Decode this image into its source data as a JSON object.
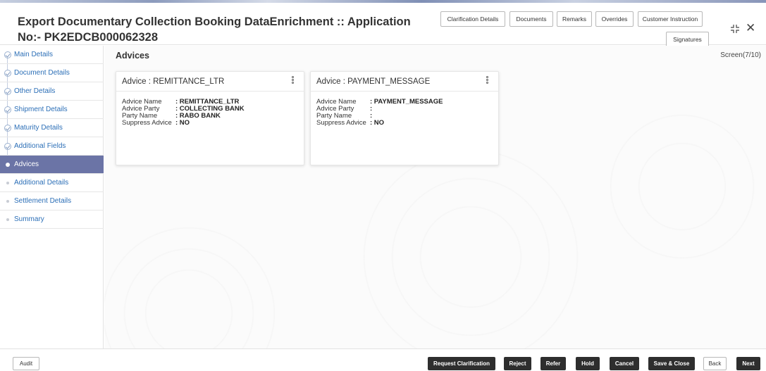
{
  "header": {
    "title": "Export Documentary Collection Booking DataEnrichment :: Application No:- PK2EDCB000062328",
    "buttons": [
      "Clarification Details",
      "Documents",
      "Remarks",
      "Overrides",
      "Customer Instruction",
      "Signatures"
    ],
    "close_glyph": "✕"
  },
  "sidebar": {
    "items": [
      {
        "label": "Main Details",
        "state": "done"
      },
      {
        "label": "Document Details",
        "state": "done"
      },
      {
        "label": "Other Details",
        "state": "done"
      },
      {
        "label": "Shipment Details",
        "state": "done"
      },
      {
        "label": "Maturity Details",
        "state": "done"
      },
      {
        "label": "Additional Fields",
        "state": "done"
      },
      {
        "label": "Advices",
        "state": "active"
      },
      {
        "label": "Additional Details",
        "state": "pending"
      },
      {
        "label": "Settlement Details",
        "state": "pending"
      },
      {
        "label": "Summary",
        "state": "pending"
      }
    ]
  },
  "main": {
    "title": "Advices",
    "screen": "Screen(7/10)",
    "cards": [
      {
        "title": "Advice : REMITTANCE_LTR",
        "rows": [
          {
            "key": "Advice Name",
            "value": ": REMITTANCE_LTR"
          },
          {
            "key": "Advice Party",
            "value": ": COLLECTING BANK"
          },
          {
            "key": "Party Name",
            "value": ": RABO BANK"
          },
          {
            "key": "Suppress Advice",
            "value": ": NO"
          }
        ]
      },
      {
        "title": "Advice : PAYMENT_MESSAGE",
        "rows": [
          {
            "key": "Advice Name",
            "value": ": PAYMENT_MESSAGE"
          },
          {
            "key": "Advice Party",
            "value": ":"
          },
          {
            "key": "Party Name",
            "value": ":"
          },
          {
            "key": "Suppress Advice",
            "value": ": NO"
          }
        ]
      }
    ]
  },
  "footer": {
    "audit": "Audit",
    "buttons": [
      "Request Clarification",
      "Reject",
      "Refer",
      "Hold",
      "Cancel",
      "Save & Close",
      "Back",
      "Next"
    ]
  },
  "colors": {
    "sidebar_active": "#6b74a6",
    "link": "#2c6fb7",
    "dark_button": "#2e2e2e"
  }
}
